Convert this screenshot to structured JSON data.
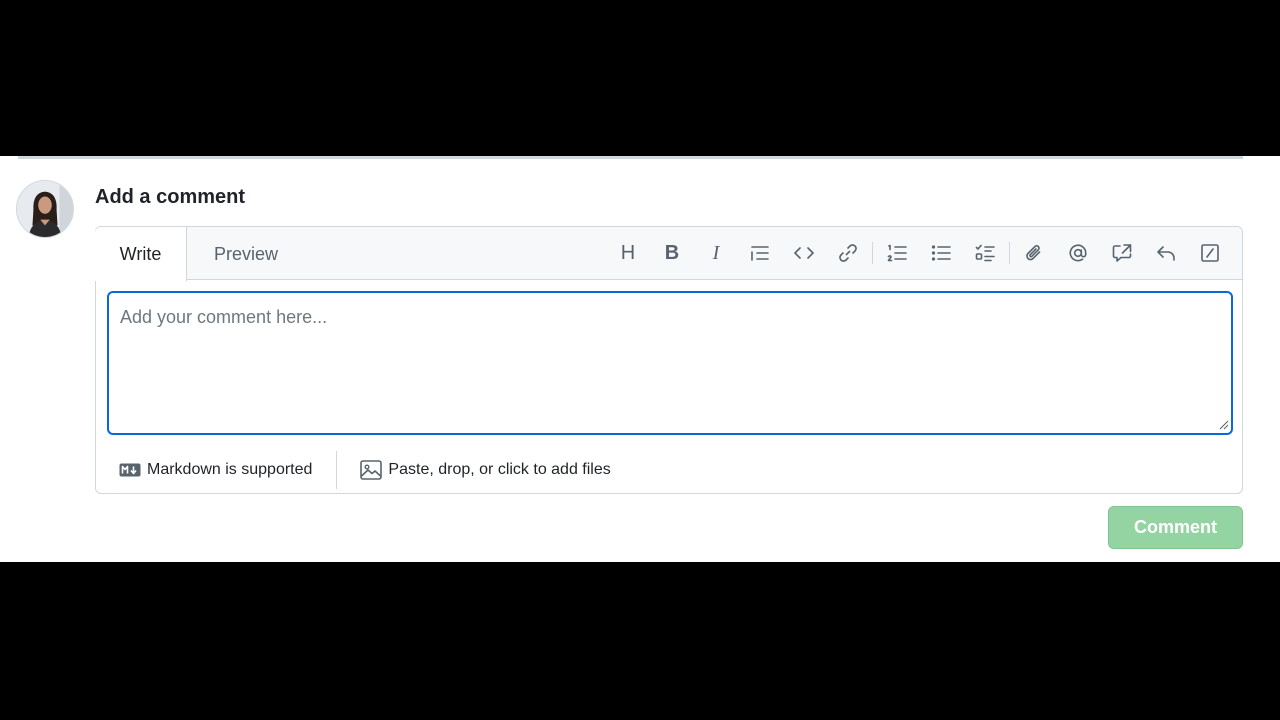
{
  "comment": {
    "title": "Add a comment",
    "tabs": {
      "write": "Write",
      "preview": "Preview"
    },
    "toolbar": {
      "heading": "H",
      "bold": "B",
      "italic": "I",
      "icons": [
        "heading-icon",
        "bold-icon",
        "italic-icon",
        "quote-icon",
        "code-icon",
        "link-icon",
        "ordered-list-icon",
        "unordered-list-icon",
        "task-list-icon",
        "attach-icon",
        "mention-icon",
        "cross-reference-icon",
        "reply-icon",
        "slash-command-icon"
      ]
    },
    "textarea": {
      "placeholder": "Add your comment here...",
      "value": ""
    },
    "footer": {
      "markdown": "Markdown is supported",
      "files": "Paste, drop, or click to add files"
    },
    "submit_label": "Comment"
  },
  "colors": {
    "focus_border": "#0969da",
    "comment_button_disabled": "#94d3a2",
    "muted_text": "#59636e"
  }
}
